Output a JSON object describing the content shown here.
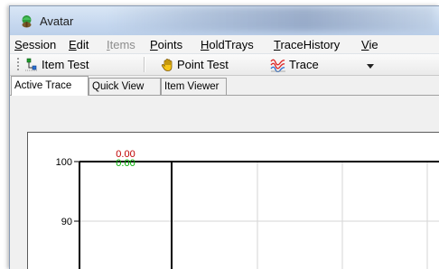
{
  "window": {
    "title": "Avatar",
    "icon": "avatar-app-icon"
  },
  "menu": {
    "items": [
      {
        "label": "Session",
        "mnemonic": "S",
        "rest": "ession",
        "enabled": true
      },
      {
        "label": "Edit",
        "mnemonic": "E",
        "rest": "dit",
        "enabled": true
      },
      {
        "label": "Items",
        "mnemonic": "I",
        "rest": "tems",
        "enabled": false
      },
      {
        "label": "Points",
        "mnemonic": "P",
        "rest": "oints",
        "enabled": true
      },
      {
        "label": "HoldTrays",
        "mnemonic": "H",
        "rest": "oldTrays",
        "enabled": true
      },
      {
        "label": "TraceHistory",
        "mnemonic": "T",
        "rest": "raceHistory",
        "enabled": true
      },
      {
        "label": "Vie",
        "mnemonic": "V",
        "rest": "ie",
        "enabled": true
      }
    ]
  },
  "toolbar": {
    "item_test": "Item Test",
    "point_test": "Point Test",
    "trace": "Trace"
  },
  "tabs": [
    {
      "label": "Active Trace",
      "active": true
    },
    {
      "label": "Quick View",
      "active": false
    },
    {
      "label": "Item Viewer",
      "active": false
    }
  ],
  "chart_data": {
    "type": "line",
    "y_ticks": [
      "100",
      "90"
    ],
    "readouts": [
      {
        "value": "0.00",
        "color": "#c00000"
      },
      {
        "value": "0.00",
        "color": "#00b000"
      }
    ],
    "grid": true
  }
}
